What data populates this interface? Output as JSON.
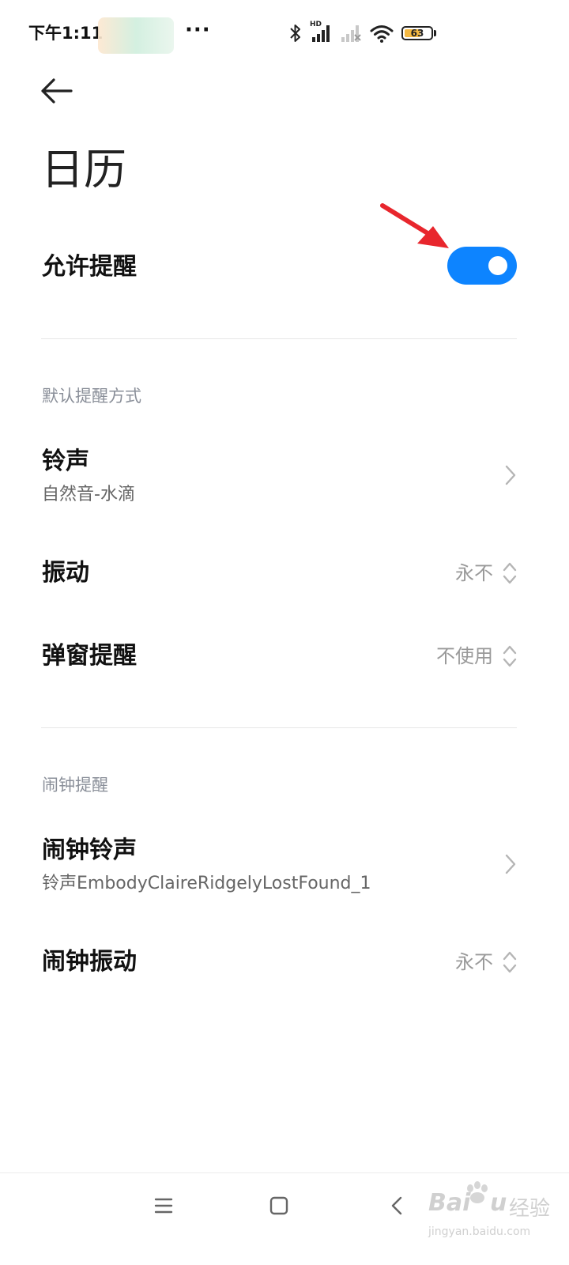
{
  "status_bar": {
    "time": "下午1:11",
    "more": "···",
    "battery_level": 63,
    "battery_text": "63",
    "network_label": "HD",
    "icons": [
      "bluetooth-icon",
      "signal-hd-icon",
      "signal-no-service-icon",
      "wifi-icon",
      "battery-icon"
    ]
  },
  "header": {
    "back_icon": "back-arrow-icon",
    "title": "日历"
  },
  "allow_reminders": {
    "label": "允许提醒",
    "enabled": true
  },
  "default_section": {
    "header": "默认提醒方式",
    "ringtone": {
      "label": "铃声",
      "value": "自然音-水滴"
    },
    "vibration": {
      "label": "振动",
      "value": "永不"
    },
    "popup": {
      "label": "弹窗提醒",
      "value": "不使用"
    }
  },
  "alarm_section": {
    "header": "闹钟提醒",
    "ringtone": {
      "label": "闹钟铃声",
      "value": "铃声EmbodyClaireRidgelyLostFound_1"
    },
    "vibration": {
      "label": "闹钟振动",
      "value": "永不"
    }
  },
  "nav_bar": {
    "icons": [
      "menu-icon",
      "home-icon",
      "back-icon"
    ]
  },
  "watermark": {
    "brand": "Bai",
    "brand_tail": "u",
    "cn": "经验",
    "url": "jingyan.baidu.com"
  },
  "colors": {
    "accent": "#0d84ff",
    "annotation": "#e8262d",
    "section_label": "#8a8f99"
  }
}
